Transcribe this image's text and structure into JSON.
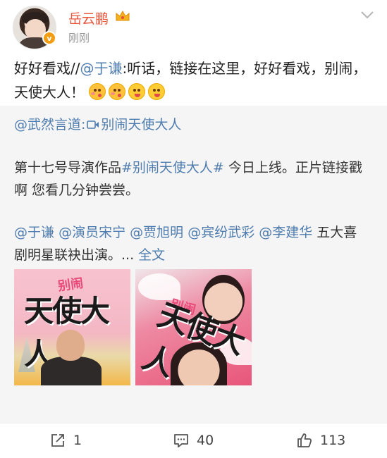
{
  "post": {
    "username": "岳云鹏",
    "timestamp": "刚刚",
    "content": {
      "prefix": "好好看戏//",
      "mention": "@于谦",
      "text": ":听话，链接在这里，好好看戏，别闹，天使大人！"
    }
  },
  "repost": {
    "author": "@武然言道",
    "separator": ":",
    "video_link": "别闹天使大人",
    "text_line1_before": "第十七号导演作品",
    "hashtag": "#别闹天使大人#",
    "text_line1_after": " 今日上线。正片链接戳啊 您看几分钟尝尝。",
    "mentions": [
      "@于谦",
      "@演员宋宁",
      "@贾旭明",
      "@宾纷武彩",
      "@李建华"
    ],
    "mentions_tail": " 五大喜剧明星联袂出演。...",
    "full_text_link": "全文",
    "poster1": {
      "title": "天使大人",
      "subtitle": "别闹"
    },
    "poster2": {
      "title": "天使大人",
      "subtitle": "别闹"
    }
  },
  "actions": {
    "repost_count": "1",
    "comment_count": "40",
    "like_count": "113"
  },
  "colors": {
    "username": "#e8563b",
    "link": "#507daf",
    "repost_bg": "#f5f5f5"
  },
  "icons": [
    "verified-badge-icon",
    "crown-icon",
    "chevron-down-icon",
    "video-icon",
    "repost-icon",
    "comment-icon",
    "like-icon"
  ]
}
